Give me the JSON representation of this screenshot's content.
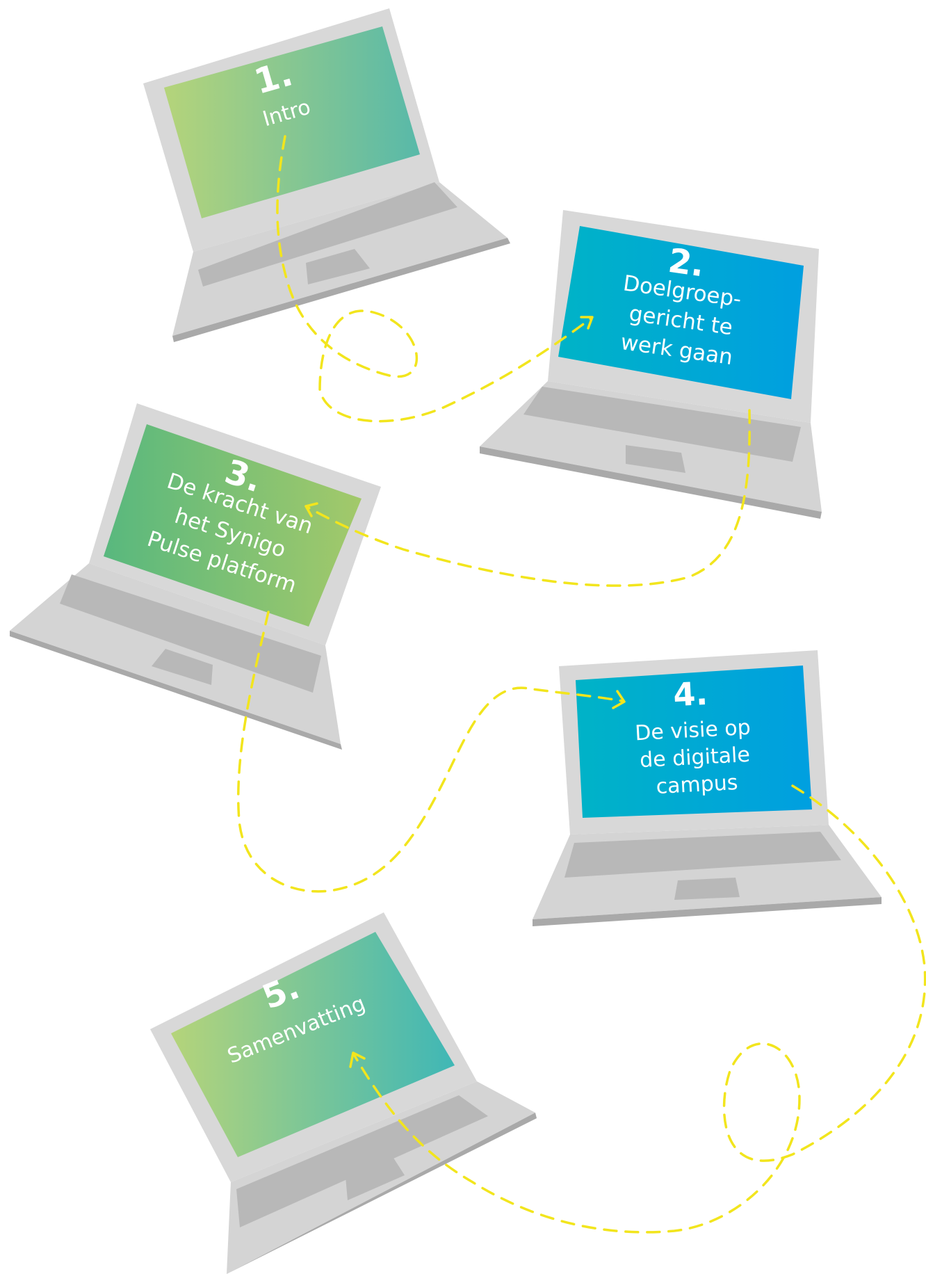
{
  "colors": {
    "laptop_frame": "#d8d8d8",
    "laptop_deck": "#d4d4d4",
    "laptop_edge": "#a9a9a9",
    "keyboard": "#b8b8b8",
    "path": "#f2e51d",
    "green_start": "#b5d47a",
    "green_end": "#58b9a9",
    "blue_start": "#00b3c7",
    "blue_end": "#009fe0",
    "green2_start": "#58b87e",
    "green2_end": "#a3c96a"
  },
  "steps": [
    {
      "number": "1.",
      "lines": [
        "Intro"
      ]
    },
    {
      "number": "2.",
      "lines": [
        "Doelgroep-",
        "gericht te",
        "werk gaan"
      ]
    },
    {
      "number": "3.",
      "lines": [
        "De kracht van",
        "het Synigo",
        "Pulse platform"
      ]
    },
    {
      "number": "4.",
      "lines": [
        "De visie op",
        "de digitale",
        "campus"
      ]
    },
    {
      "number": "5.",
      "lines": [
        "Samenvatting"
      ]
    }
  ]
}
